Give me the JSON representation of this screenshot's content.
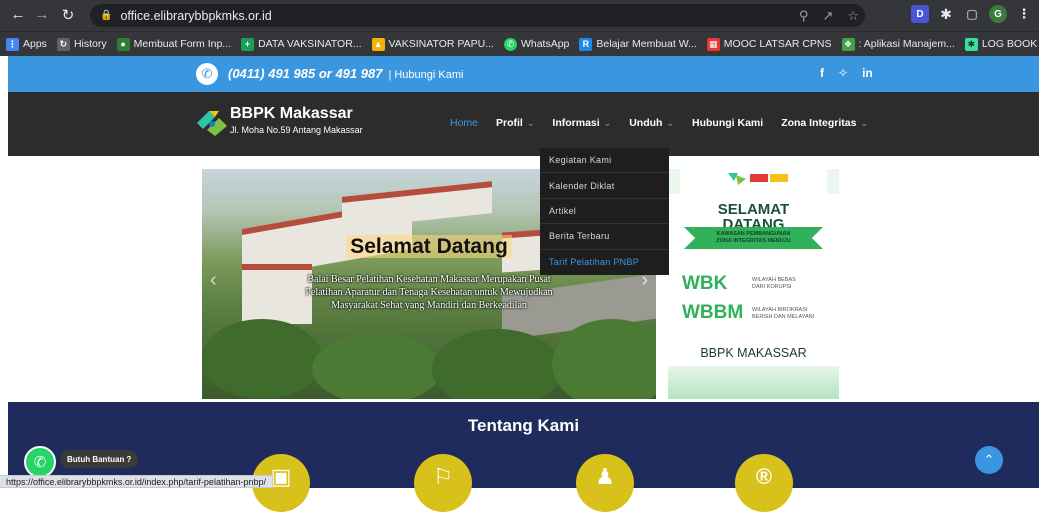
{
  "browser": {
    "url": "office.elibrarybbpkmks.or.id",
    "bookmarks": [
      {
        "label": "Apps",
        "icon": "apps-grid-icon",
        "color": "#4285f4"
      },
      {
        "label": "History",
        "icon": "history-icon",
        "color": "#5f6368"
      },
      {
        "label": "Membuat Form Inp...",
        "icon": "site-icon",
        "color": "#2e7d32"
      },
      {
        "label": "DATA VAKSINATOR...",
        "icon": "cross-icon",
        "color": "#1a9e5a"
      },
      {
        "label": "VAKSINATOR PAPU...",
        "icon": "drive-icon",
        "color": "#f4b400"
      },
      {
        "label": "WhatsApp",
        "icon": "whatsapp-icon",
        "color": "#25d366"
      },
      {
        "label": "Belajar Membuat W...",
        "icon": "r-icon",
        "color": "#1e88e5"
      },
      {
        "label": "MOOC LATSAR CPNS",
        "icon": "mooc-icon",
        "color": "#e53935"
      },
      {
        "label": ": Aplikasi Manajem...",
        "icon": "app-icon",
        "color": "#43a047"
      },
      {
        "label": "LOG BOOK | Linktree",
        "icon": "linktree-icon",
        "color": "#39e09b"
      }
    ]
  },
  "topbar": {
    "phone": "(0411) 491 985 or 491 987",
    "contact_label": "| Hubungi Kami",
    "socials": [
      "f",
      "♥",
      "in"
    ]
  },
  "navbar": {
    "brand": "BBPK Makassar",
    "address": "Jl. Moha No.59 Antang Makassar",
    "menu": [
      {
        "label": "Home",
        "active": true,
        "caret": false
      },
      {
        "label": "Profil",
        "active": false,
        "caret": true
      },
      {
        "label": "Informasi",
        "active": false,
        "caret": true
      },
      {
        "label": "Unduh",
        "active": false,
        "caret": true
      },
      {
        "label": "Hubungi Kami",
        "active": false,
        "caret": false
      },
      {
        "label": "Zona Integritas",
        "active": false,
        "caret": true
      }
    ]
  },
  "dropdown": {
    "items": [
      {
        "label": "Kegiatan Kami",
        "highlighted": false
      },
      {
        "label": "Kalender Diklat",
        "highlighted": false
      },
      {
        "label": "Artikel",
        "highlighted": false
      },
      {
        "label": "Berita Terbaru",
        "highlighted": false
      },
      {
        "label": "Tarif Pelatihan PNBP",
        "highlighted": true
      }
    ]
  },
  "slider": {
    "title": "Selamat Datang",
    "body": "Balai Besar Pelatihan Kesehatan Makassar Merupakan Pusat Pelatihan Aparatur dan Tenaga Kesehatan untuk Mewujudkan Masyarakat Sehat yang Mandiri dan Berkeadilan",
    "prev": "‹",
    "next": "›"
  },
  "poster": {
    "title_line1": "SELAMAT",
    "title_line2": "DATANG",
    "band_line1": "KAWASAN PEMBANGUNAN",
    "band_line2": "ZONA INTEGRITAS MENUJU",
    "wbk": "WBK",
    "wbk_sub1": "WILAYAH BEBAS",
    "wbk_sub2": "DARI KORUPSI",
    "wbbm": "WBBM",
    "wbbm_sub1": "WILAYAH BIROKRASI",
    "wbbm_sub2": "BERSIH DAN MELAYANI",
    "org": "BBPK MAKASSAR"
  },
  "about": {
    "title": "Tentang Kami"
  },
  "whatsapp": {
    "label": "Butuh Bantuan ?"
  },
  "status_url": "https://office.elibrarybbpkmks.or.id/index.php/tarif-pelatihan-pnbp/"
}
